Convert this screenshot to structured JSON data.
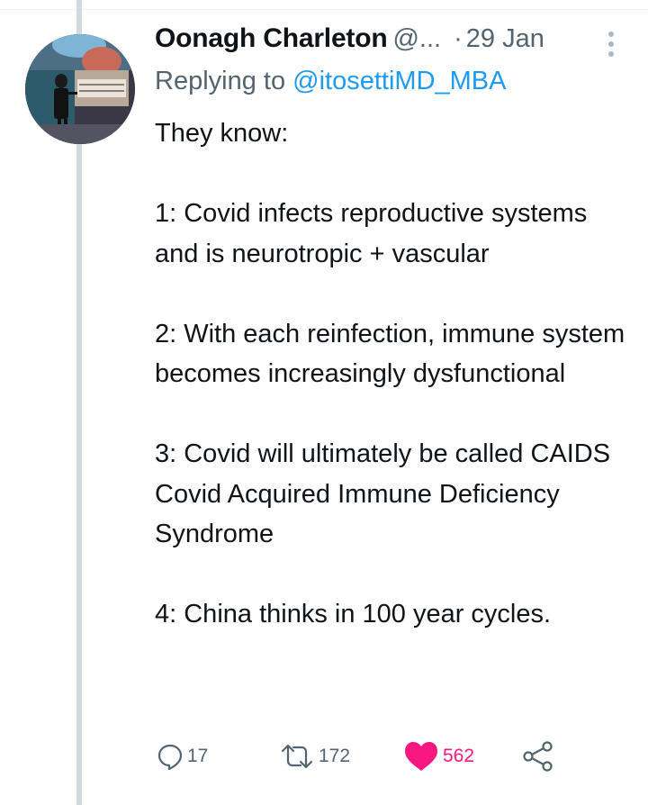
{
  "tweet": {
    "author": {
      "display_name": "Oonagh Charleton",
      "handle": "@..."
    },
    "separator": "·",
    "date": "29 Jan",
    "replying_prefix": "Replying to",
    "replying_to": "@itosettiMD_MBA",
    "text": "They know:\n\n1: Covid infects reproductive systems and is neurotropic + vascular\n\n2: With each reinfection, immune system becomes increasingly dysfunctional\n\n3: Covid will ultimately be called CAIDS Covid Acquired Immune Deficiency Syndrome\n\n4: China thinks in 100 year cycles.",
    "actions": {
      "replies": "17",
      "retweets": "172",
      "likes": "562"
    }
  },
  "icons": {
    "reply": "comment-bubble-icon",
    "retweet": "retweet-arrows-icon",
    "like": "heart-icon",
    "share": "share-nodes-icon",
    "more": "vertical-dots-icon"
  },
  "colors": {
    "text": "#0f1419",
    "secondary": "#536471",
    "link": "#1d9bf0",
    "like": "#f91880",
    "thread_line": "#cfd9de"
  }
}
